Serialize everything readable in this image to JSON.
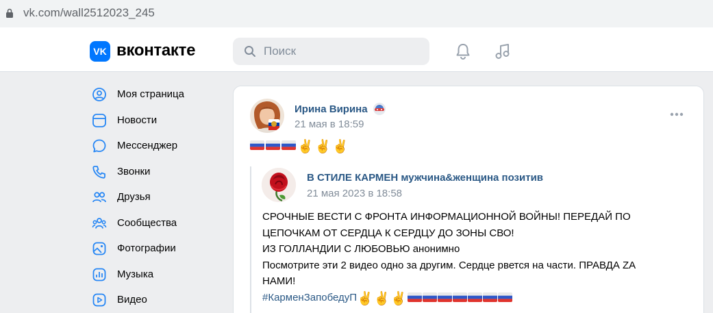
{
  "browser": {
    "url": "vk.com/wall2512023_245"
  },
  "header": {
    "logo_mark": "VK",
    "logo_text": "вконтакте",
    "search_placeholder": "Поиск",
    "icons": [
      "bell-icon",
      "music-icon",
      "search-icon"
    ]
  },
  "sidebar": {
    "items": [
      {
        "label": "Моя страница",
        "icon": "profile-icon"
      },
      {
        "label": "Новости",
        "icon": "news-icon"
      },
      {
        "label": "Мессенджер",
        "icon": "messenger-icon"
      },
      {
        "label": "Звонки",
        "icon": "phone-icon"
      },
      {
        "label": "Друзья",
        "icon": "friends-icon"
      },
      {
        "label": "Сообщества",
        "icon": "communities-icon"
      },
      {
        "label": "Фотографии",
        "icon": "photos-icon"
      },
      {
        "label": "Музыка",
        "icon": "music-icon"
      },
      {
        "label": "Видео",
        "icon": "video-icon"
      }
    ]
  },
  "post": {
    "author": "Ирина Вирина",
    "date": "21 мая в 18:59",
    "emoji": [
      "ru-flag",
      "ru-flag",
      "ru-flag",
      "victory-hand",
      "victory-hand",
      "victory-hand"
    ],
    "repost": {
      "author": "В СТИЛЕ КАРМЕН мужчина&женщина позитив",
      "date": "21 мая 2023 в 18:58",
      "lines": [
        "СРОЧНЫЕ ВЕСТИ С ФРОНТА ИНФОРМАЦИОННОЙ ВОЙНЫ! ПЕРЕДАЙ ПО",
        "ЦЕПОЧКАМ ОТ СЕРДЦА К СЕРДЦУ ДО ЗОНЫ СВО!",
        "ИЗ ГОЛЛАНДИИ С ЛЮБОВЬЮ анонимно",
        "Посмотрите эти 2 видео одно за другим. Сердце рвется на части. ПРАВДА ZA",
        "НАМИ!"
      ],
      "hashtag": "#КарменЗапобедуП",
      "hashtag_emoji": [
        "victory-hand",
        "victory-hand",
        "victory-hand",
        "ru-flag",
        "ru-flag",
        "ru-flag",
        "ru-flag",
        "ru-flag",
        "ru-flag",
        "ru-flag"
      ]
    }
  },
  "colors": {
    "vk_blue": "#0077ff",
    "link": "#2a5885",
    "muted": "#818c99",
    "page_bg": "#edeef0"
  }
}
